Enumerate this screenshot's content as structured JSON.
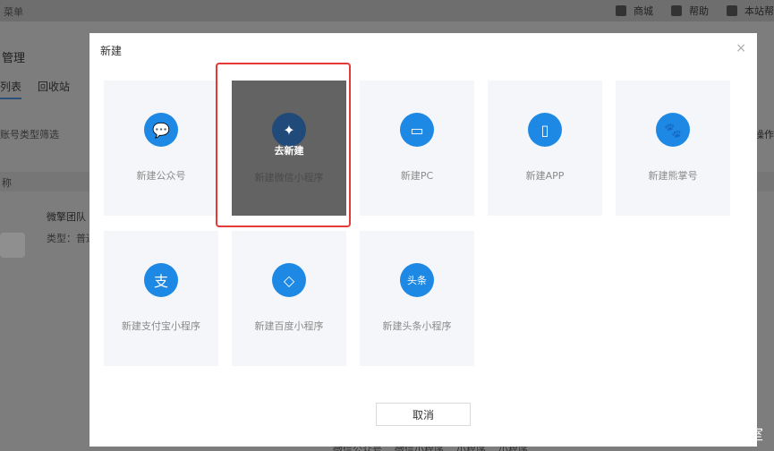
{
  "background": {
    "menu": "菜单",
    "top_links": [
      "商城",
      "帮助",
      "本站帮"
    ],
    "page_title": "管理",
    "tabs": [
      "列表",
      "回收站"
    ],
    "filter": "账号类型筛选",
    "ops": "操作",
    "column": "称",
    "team_name": "微擎团队",
    "team_type": "类型：普通",
    "bottom": [
      "微信公众号",
      "微信小程序",
      "小程序",
      "小程序"
    ]
  },
  "modal": {
    "title": "新建",
    "close": "×",
    "tiles": [
      {
        "label": "新建公众号",
        "icon": "wechat-icon",
        "glyph": "💬"
      },
      {
        "label": "新建微信小程序",
        "icon": "miniprogram-icon",
        "glyph": "✦",
        "hover_text": "去新建"
      },
      {
        "label": "新建PC",
        "icon": "monitor-icon",
        "glyph": "▭"
      },
      {
        "label": "新建APP",
        "icon": "phone-icon",
        "glyph": "▯"
      },
      {
        "label": "新建熊掌号",
        "icon": "paw-icon",
        "glyph": "🐾"
      },
      {
        "label": "新建支付宝小程序",
        "icon": "alipay-icon",
        "glyph": "支"
      },
      {
        "label": "新建百度小程序",
        "icon": "baidu-icon",
        "glyph": "◇"
      },
      {
        "label": "新建头条小程序",
        "icon": "toutiao-icon",
        "glyph": "头条"
      }
    ],
    "cancel": "取消"
  },
  "watermark": "CSDN @虎蔚智客工作室",
  "colors": {
    "accent": "#1e88e5",
    "highlight": "#e53935",
    "tile_bg": "#f4f6f9"
  }
}
